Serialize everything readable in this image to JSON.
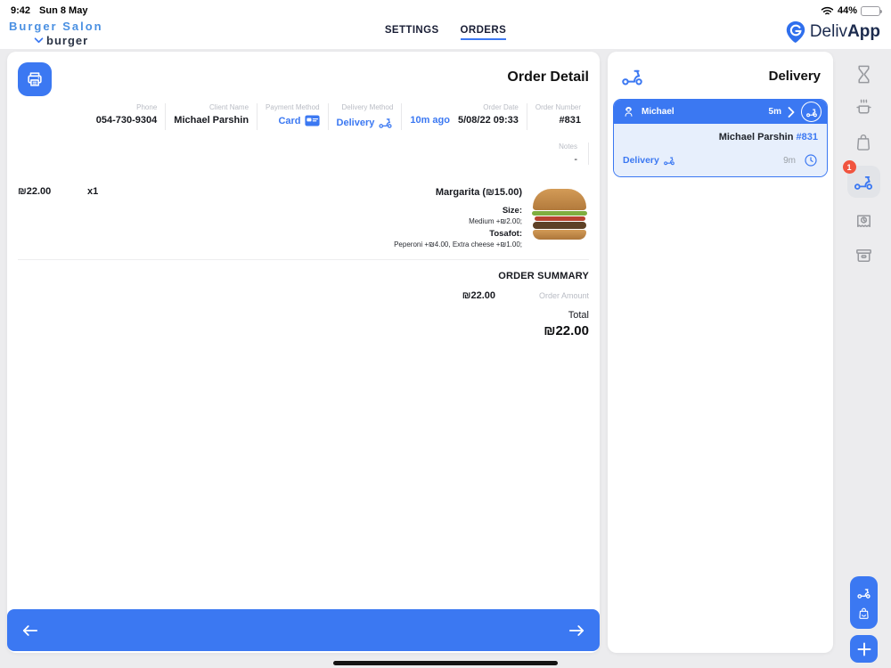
{
  "status_bar": {
    "time": "9:42",
    "date": "Sun 8 May",
    "battery_percent": "44%"
  },
  "header": {
    "restaurant_name": "Burger Salon",
    "branch_name": "burger",
    "tab_settings": "SETTINGS",
    "tab_orders": "ORDERS",
    "logo_regular": "Deliv",
    "logo_bold": "App"
  },
  "order_detail": {
    "title": "Order Detail",
    "fields": [
      {
        "label": "Phone",
        "value": "054-730-9304"
      },
      {
        "label": "Client Name",
        "value": "Michael Parshin"
      },
      {
        "label": "Payment Method",
        "value": "Card"
      },
      {
        "label": "Delivery Method",
        "value": "Delivery"
      },
      {
        "label": "Order Date",
        "ago": "10m ago",
        "value": "5/08/22 09:33"
      },
      {
        "label": "Order Number",
        "value": "#831"
      }
    ],
    "notes_label": "Notes",
    "notes_value": "-",
    "item": {
      "line_total": "₪22.00",
      "quantity": "x1",
      "name": "Margarita (₪15.00)",
      "option_groups": [
        {
          "label": "Size:",
          "value": "Medium +₪2.00;"
        },
        {
          "label": "Tosafot:",
          "value": "Peperoni +₪4.00, Extra cheese +₪1.00;"
        }
      ]
    },
    "summary": {
      "title": "ORDER SUMMARY",
      "amount_value": "₪22.00",
      "amount_label": "Order Amount",
      "total_label": "Total",
      "total_value": "₪22.00"
    }
  },
  "delivery_panel": {
    "title": "Delivery",
    "courier": {
      "name": "Michael",
      "time": "5m",
      "client_name": "Michael Parshin",
      "order_number": "#831",
      "status_label": "Delivery",
      "eta": "9m"
    }
  },
  "sidebar": {
    "badge_count": "1"
  },
  "colors": {
    "accent_blue": "#3b78f2",
    "light_blue_bg": "#e7effc",
    "badge_red": "#f1543f"
  }
}
